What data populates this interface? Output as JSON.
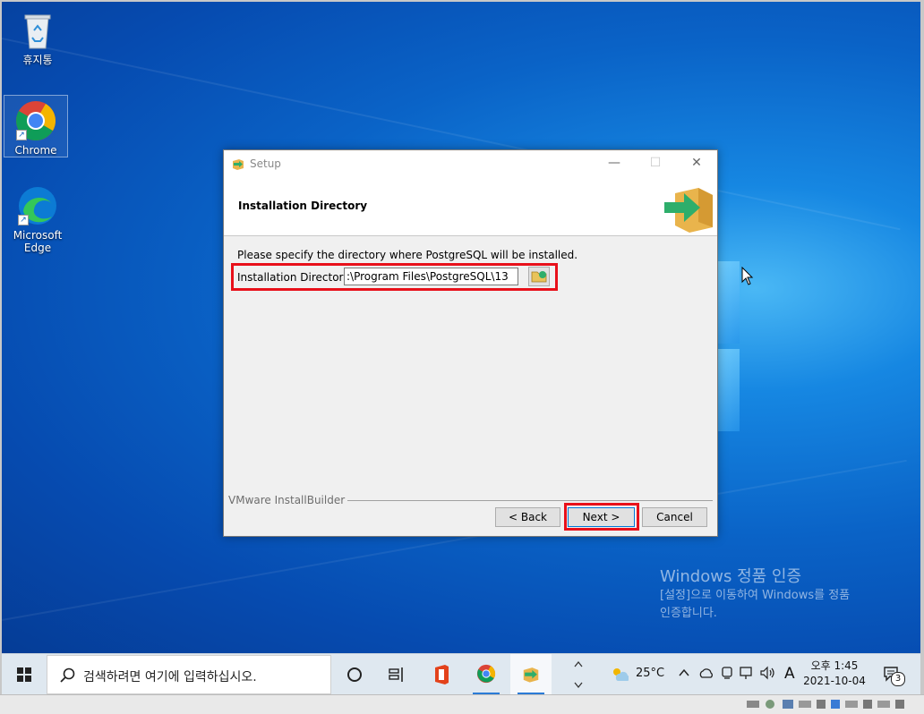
{
  "desktop": {
    "icons": [
      {
        "label": "휴지통"
      },
      {
        "label": "Chrome"
      },
      {
        "label": "Microsoft Edge"
      }
    ],
    "watermark": {
      "line1": "Windows 정품 인증",
      "line2": "[설정]으로 이동하여 Windows를 정품",
      "line3": "인증합니다."
    }
  },
  "dialog": {
    "window_title": "Setup",
    "minimize": "—",
    "maximize": "☐",
    "close": "✕",
    "header_title": "Installation Directory",
    "prompt": "Please specify the directory where PostgreSQL will be installed.",
    "dir_label": "Installation Directory",
    "dir_value": ":\\Program Files\\PostgreSQL\\13",
    "brand": "VMware InstallBuilder",
    "back_label": "< Back",
    "next_label": "Next >",
    "cancel_label": "Cancel"
  },
  "taskbar": {
    "search_placeholder": "검색하려면 여기에 입력하십시오.",
    "weather": "25°C",
    "ime": "A",
    "time": "오후 1:45",
    "date": "2021-10-04",
    "notification_count": "3"
  },
  "colors": {
    "highlight": "#e8101a",
    "desktop_blue": "#0a63c7",
    "taskbar": "#dfe8f0"
  }
}
